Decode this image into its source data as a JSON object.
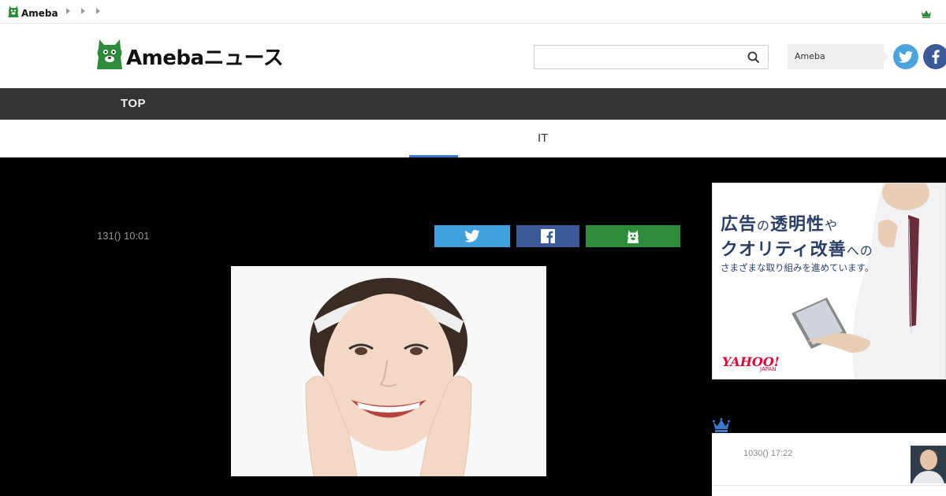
{
  "util_bar": {
    "logo_text": "Ameba"
  },
  "header": {
    "brand_text": "Amebaニュース",
    "search": {
      "placeholder": "",
      "value": ""
    },
    "ameba_button_label": "Ameba"
  },
  "nav": {
    "items": [
      {
        "label": "TOP"
      }
    ]
  },
  "category": {
    "active_label": "IT"
  },
  "article": {
    "date": "131() 10:01"
  },
  "ad": {
    "line1_big": "広告",
    "line1_small": "の",
    "line1_rest": "透明性",
    "line1_tail": "や",
    "line2_main": "クオリティ改善",
    "line2_tail": "への",
    "line3": "さまざまな取り組みを進めています。",
    "logo": "YAHOO!",
    "logo_sub": "JAPAN"
  },
  "ranking": {
    "items": [
      {
        "date": "1030() 17:22"
      }
    ]
  },
  "colors": {
    "accent_blue": "#3a78c9",
    "ameba_green": "#2d8c3c",
    "twitter": "#3ea1dd",
    "facebook": "#3b5998",
    "nav_bg": "#333333"
  }
}
